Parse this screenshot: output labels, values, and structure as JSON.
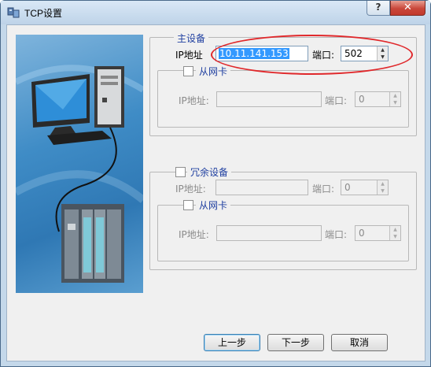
{
  "window": {
    "title": "TCP设置",
    "help_label": "?",
    "close_label": "✕"
  },
  "primary": {
    "legend": "主设备",
    "ip_label": "IP地址",
    "ip_value": "10.11.141.153",
    "port_label": "端口:",
    "port_value": "502",
    "secondary_nic": {
      "legend": "从网卡",
      "ip_label": "IP地址:",
      "ip_value": "",
      "port_label": "端口:",
      "port_value": "0"
    }
  },
  "redundant": {
    "legend": "冗余设备",
    "ip_label": "IP地址:",
    "ip_value": "",
    "port_label": "端口:",
    "port_value": "0",
    "secondary_nic": {
      "legend": "从网卡",
      "ip_label": "IP地址:",
      "ip_value": "",
      "port_label": "端口:",
      "port_value": "0"
    }
  },
  "buttons": {
    "prev": "上一步",
    "next": "下一步",
    "cancel": "取消"
  },
  "colors": {
    "annotation": "#e0282b",
    "legend_text": "#1f3fa0",
    "selection": "#3399ff"
  },
  "icons": {
    "app": "network-settings-icon",
    "image": "computer-plc-illustration"
  }
}
